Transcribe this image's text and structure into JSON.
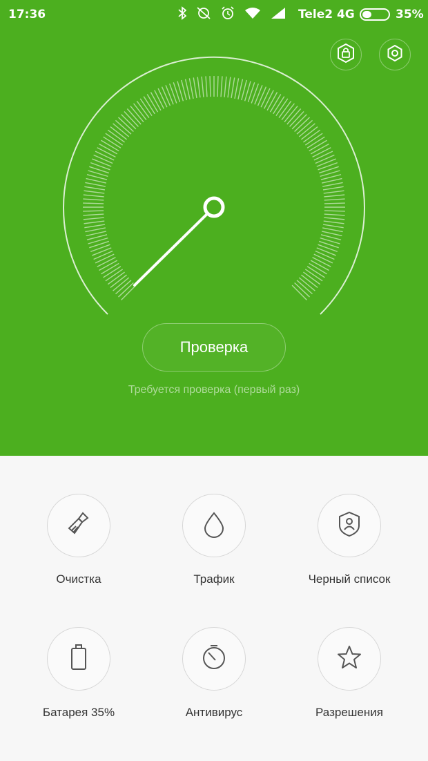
{
  "status_bar": {
    "time": "17:36",
    "carrier": "Tele2 4G",
    "battery_percent_text": "35%",
    "battery_level": 0.35,
    "icons": [
      "bluetooth-icon",
      "sync-off-icon",
      "alarm-icon",
      "wifi-icon",
      "signal-icon"
    ]
  },
  "header": {
    "icons": [
      "shield-lock-icon",
      "gear-icon"
    ]
  },
  "gauge": {
    "needle_level": 0.0
  },
  "scan": {
    "button_label": "Проверка",
    "note": "Требуется проверка (первый раз)"
  },
  "tiles": [
    {
      "label": "Очистка",
      "icon": "broom-icon"
    },
    {
      "label": "Трафик",
      "icon": "drop-icon"
    },
    {
      "label": "Черный список",
      "icon": "shield-user-icon"
    },
    {
      "label": "Батарея 35%",
      "icon": "battery-icon"
    },
    {
      "label": "Антивирус",
      "icon": "antivirus-icon"
    },
    {
      "label": "Разрешения",
      "icon": "star-icon"
    }
  ],
  "colors": {
    "accent": "#4caf1f",
    "background": "#f7f7f7"
  }
}
